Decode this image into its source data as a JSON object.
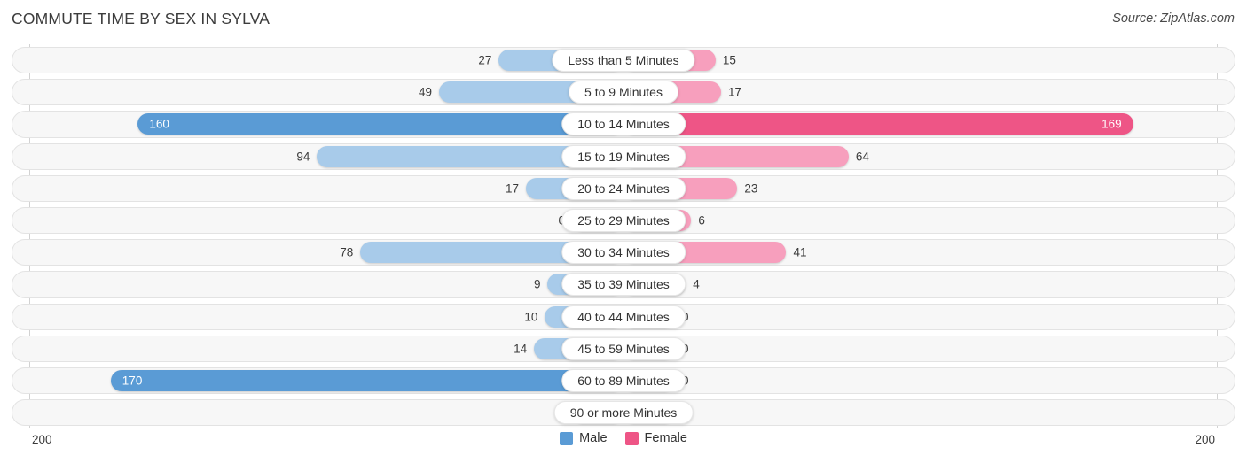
{
  "header": {
    "title": "COMMUTE TIME BY SEX IN SYLVA",
    "source": "Source: ZipAtlas.com"
  },
  "legend": {
    "male_label": "Male",
    "female_label": "Female",
    "male_color": "#5a9bd5",
    "female_color": "#ee5586"
  },
  "axis": {
    "left_tick": "200",
    "right_tick": "200",
    "max": 200
  },
  "colors": {
    "male_light": "#a8cbea",
    "male_dark": "#5a9bd5",
    "female_light": "#f79fbd",
    "female_dark": "#ee5586",
    "track_fill": "#f7f7f7",
    "track_border": "#e3e3e3"
  },
  "chart_data": {
    "type": "bar",
    "title": "COMMUTE TIME BY SEX IN SYLVA",
    "subtitle": "Source: ZipAtlas.com",
    "orientation": "horizontal-diverging",
    "xlabel": "",
    "ylabel": "",
    "xlim": [
      200,
      200
    ],
    "grid": false,
    "legend_position": "bottom-center",
    "categories": [
      "Less than 5 Minutes",
      "5 to 9 Minutes",
      "10 to 14 Minutes",
      "15 to 19 Minutes",
      "20 to 24 Minutes",
      "25 to 29 Minutes",
      "30 to 34 Minutes",
      "35 to 39 Minutes",
      "40 to 44 Minutes",
      "45 to 59 Minutes",
      "60 to 89 Minutes",
      "90 or more Minutes"
    ],
    "series": [
      {
        "name": "Male",
        "values": [
          27,
          49,
          160,
          94,
          17,
          0,
          78,
          9,
          10,
          14,
          170,
          0
        ]
      },
      {
        "name": "Female",
        "values": [
          15,
          17,
          169,
          64,
          23,
          6,
          41,
          4,
          0,
          0,
          0,
          0
        ]
      }
    ]
  },
  "rows": [
    {
      "category": "Less than 5 Minutes",
      "male": "27",
      "female": "15",
      "male_hi": false,
      "female_hi": false
    },
    {
      "category": "5 to 9 Minutes",
      "male": "49",
      "female": "17",
      "male_hi": false,
      "female_hi": false
    },
    {
      "category": "10 to 14 Minutes",
      "male": "160",
      "female": "169",
      "male_hi": true,
      "female_hi": true
    },
    {
      "category": "15 to 19 Minutes",
      "male": "94",
      "female": "64",
      "male_hi": false,
      "female_hi": false
    },
    {
      "category": "20 to 24 Minutes",
      "male": "17",
      "female": "23",
      "male_hi": false,
      "female_hi": false
    },
    {
      "category": "25 to 29 Minutes",
      "male": "0",
      "female": "6",
      "male_hi": false,
      "female_hi": false
    },
    {
      "category": "30 to 34 Minutes",
      "male": "78",
      "female": "41",
      "male_hi": false,
      "female_hi": false
    },
    {
      "category": "35 to 39 Minutes",
      "male": "9",
      "female": "4",
      "male_hi": false,
      "female_hi": false
    },
    {
      "category": "40 to 44 Minutes",
      "male": "10",
      "female": "0",
      "male_hi": false,
      "female_hi": false
    },
    {
      "category": "45 to 59 Minutes",
      "male": "14",
      "female": "0",
      "male_hi": false,
      "female_hi": false
    },
    {
      "category": "60 to 89 Minutes",
      "male": "170",
      "female": "0",
      "male_hi": true,
      "female_hi": false
    },
    {
      "category": "90 or more Minutes",
      "male": "0",
      "female": "0",
      "male_hi": false,
      "female_hi": false
    }
  ]
}
